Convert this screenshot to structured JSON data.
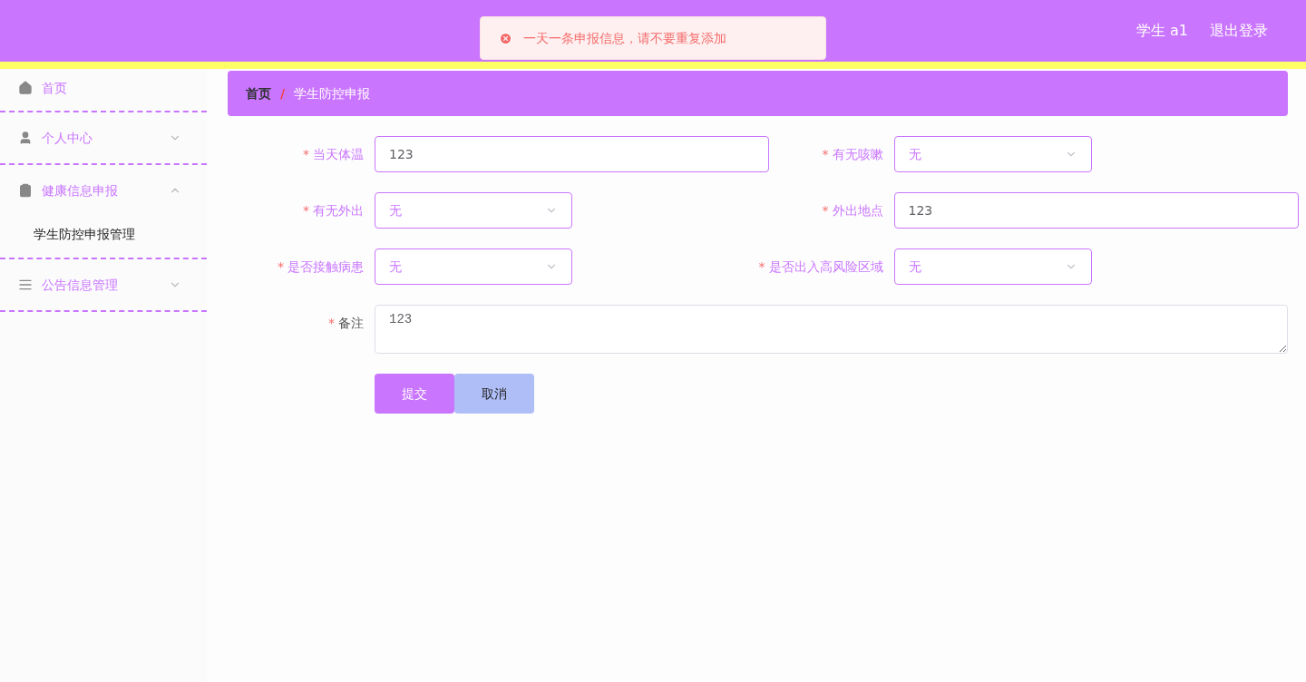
{
  "header": {
    "user": "学生 a1",
    "logout": "退出登录"
  },
  "toast": {
    "kind": "error",
    "message": "一天一条申报信息，请不要重复添加"
  },
  "sidebar": {
    "items": [
      {
        "label": "首页"
      },
      {
        "label": "个人中心",
        "expanded": false
      },
      {
        "label": "健康信息申报",
        "expanded": true,
        "children": [
          {
            "label": "学生防控申报管理"
          }
        ]
      },
      {
        "label": "公告信息管理",
        "expanded": false
      }
    ]
  },
  "breadcrumb": {
    "items": [
      "首页",
      "学生防控申报"
    ],
    "separator": "/"
  },
  "form": {
    "fields": [
      {
        "mark": "*",
        "label": "当天体温",
        "kind": "input",
        "value": "123"
      },
      {
        "mark": "*",
        "label": "有无咳嗽",
        "kind": "select",
        "value": "无"
      },
      {
        "mark": "*",
        "label": "有无外出",
        "kind": "select",
        "value": "无"
      },
      {
        "mark": "*",
        "label": "外出地点",
        "kind": "input",
        "value": "123"
      },
      {
        "mark": "*",
        "label": "是否接触病患",
        "kind": "select",
        "value": "无"
      },
      {
        "mark": "*",
        "label": "是否出入高风险区域",
        "kind": "select",
        "value": "无"
      },
      {
        "mark": "*",
        "label": "备注",
        "kind": "textarea",
        "value": "123"
      }
    ],
    "buttons": [
      {
        "label": "提交",
        "kind": "primary"
      },
      {
        "label": "取消",
        "kind": "secondary"
      }
    ]
  }
}
